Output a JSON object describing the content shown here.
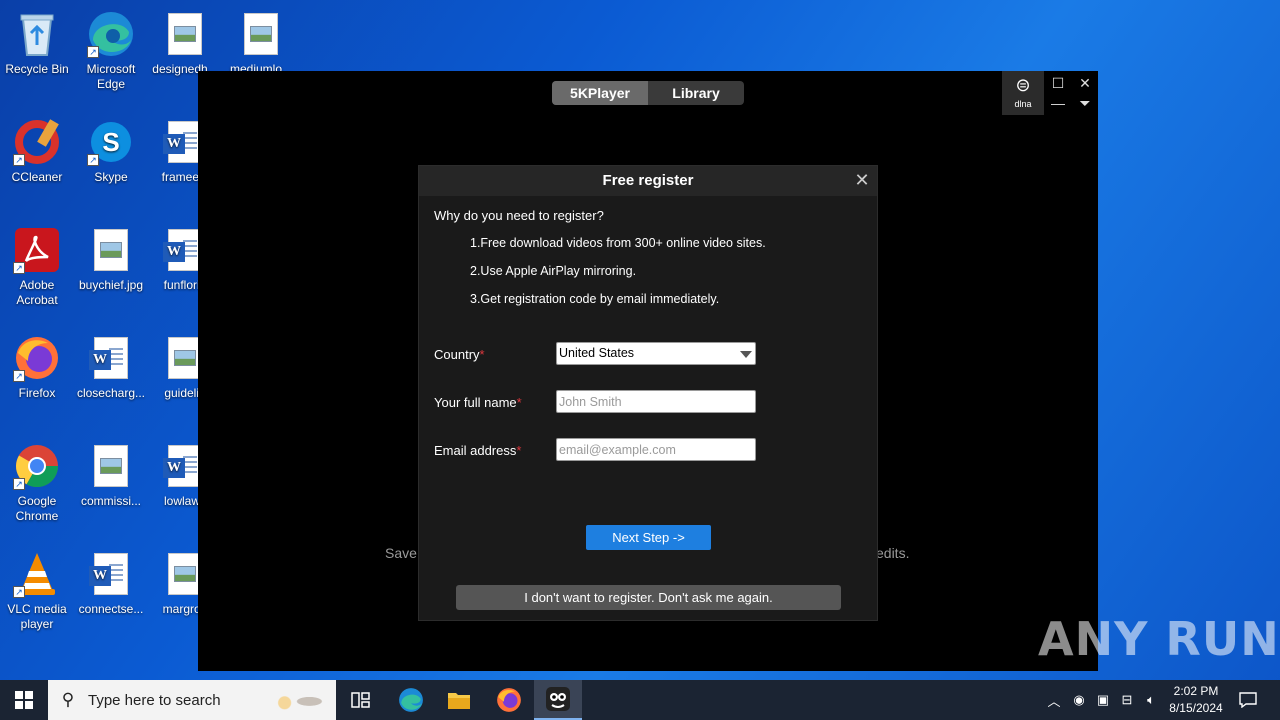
{
  "desktop_icons": [
    {
      "label": "Recycle Bin",
      "icon": "recycle-bin-icon"
    },
    {
      "label": "Microsoft Edge",
      "icon": "edge-icon"
    },
    {
      "label": "designedh...",
      "icon": "image-file-icon"
    },
    {
      "label": "mediumlo...",
      "icon": "image-file-icon"
    },
    {
      "label": "CCleaner",
      "icon": "ccleaner-icon"
    },
    {
      "label": "Skype",
      "icon": "skype-icon"
    },
    {
      "label": "frameedi",
      "icon": "word-doc-icon"
    },
    {
      "label": "Adobe Acrobat",
      "icon": "acrobat-icon"
    },
    {
      "label": "buychief.jpg",
      "icon": "image-file-icon"
    },
    {
      "label": "funflorid",
      "icon": "word-doc-icon"
    },
    {
      "label": "Firefox",
      "icon": "firefox-icon"
    },
    {
      "label": "closecharg...",
      "icon": "word-doc-icon"
    },
    {
      "label": "guidelin",
      "icon": "image-file-icon"
    },
    {
      "label": "Google Chrome",
      "icon": "chrome-icon"
    },
    {
      "label": "commissi...",
      "icon": "image-file-icon"
    },
    {
      "label": "lowlaws",
      "icon": "word-doc-icon"
    },
    {
      "label": "VLC media player",
      "icon": "vlc-icon"
    },
    {
      "label": "connectse...",
      "icon": "word-doc-icon"
    },
    {
      "label": "margrou",
      "icon": "image-file-icon"
    }
  ],
  "player": {
    "tabs": [
      {
        "label": "5KPlayer",
        "active": true
      },
      {
        "label": "Library",
        "active": false
      }
    ],
    "dlna_label": "dlna",
    "behind_left": "Save",
    "behind_right": "edits."
  },
  "dialog": {
    "title": "Free register",
    "why": "Why do you need to register?",
    "reasons": [
      "1.Free download videos from 300+ online video sites.",
      "2.Use Apple AirPlay mirroring.",
      "3.Get registration code by email immediately."
    ],
    "country_label": "Country",
    "country_value": "United States",
    "name_label": "Your full name",
    "name_placeholder": "John Smith",
    "name_value": "",
    "email_label": "Email address",
    "email_placeholder": "email@example.com",
    "email_value": "",
    "required_mark": "*",
    "next_button": "Next Step ->",
    "no_register_button": "I don't want to register. Don't ask me again."
  },
  "watermark": "ANY RUN",
  "taskbar": {
    "search_placeholder": "Type here to search",
    "time": "2:02 PM",
    "date": "8/15/2024"
  },
  "colors": {
    "accent_button": "#1e7fe0",
    "required_star": "#e0383e",
    "dialog_bg": "#1a1a1a",
    "taskbar_bg": "#1b2433"
  }
}
